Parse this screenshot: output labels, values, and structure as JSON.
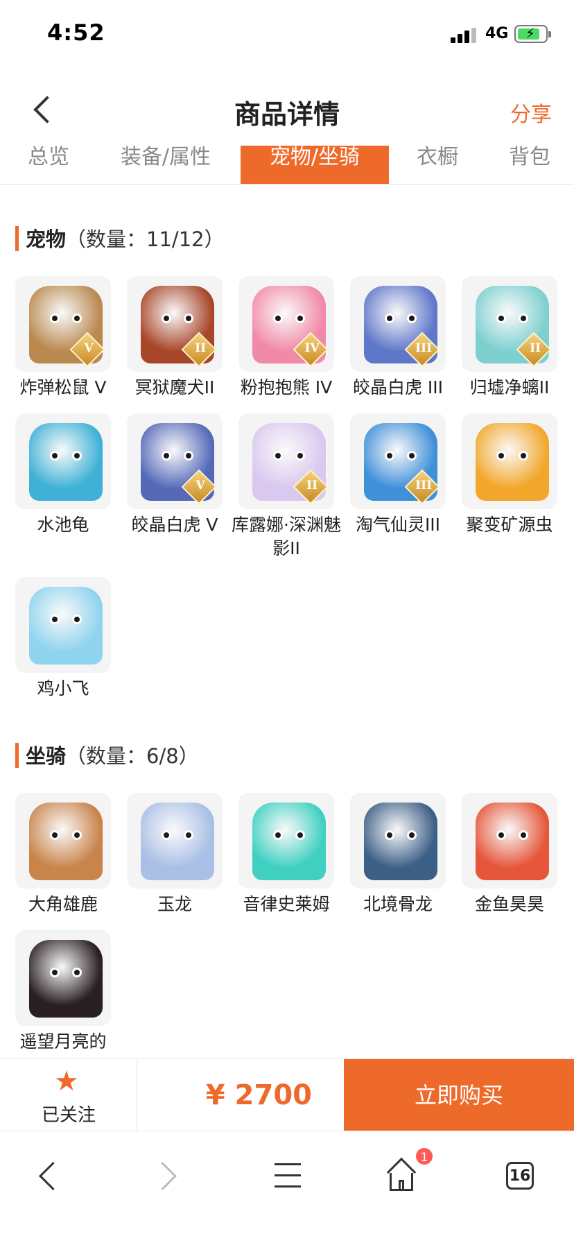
{
  "status": {
    "time": "4:52",
    "network": "4G"
  },
  "header": {
    "title": "商品详情",
    "share": "分享"
  },
  "tabs": [
    {
      "label": "总览",
      "active": false
    },
    {
      "label": "装备/属性",
      "active": false
    },
    {
      "label": "宠物/坐骑",
      "active": true
    },
    {
      "label": "衣橱",
      "active": false
    },
    {
      "label": "背包",
      "active": false
    }
  ],
  "pets": {
    "name": "宠物",
    "count": "（数量：11/12）",
    "items": [
      {
        "label": "炸弹松鼠 V",
        "icon": "squirrel-icon",
        "color": "#b9894f",
        "rank": "V"
      },
      {
        "label": "冥狱魔犬II",
        "icon": "hellhound-icon",
        "color": "#a8462a",
        "rank": "II"
      },
      {
        "label": "粉抱抱熊 IV",
        "icon": "pink-bear-icon",
        "color": "#f18aa8",
        "rank": "IV"
      },
      {
        "label": "皎晶白虎 III",
        "icon": "white-tiger-icon",
        "color": "#5f77c9",
        "rank": "III"
      },
      {
        "label": "归墟净螭II",
        "icon": "water-dragon-icon",
        "color": "#7ecfcf",
        "rank": "II"
      },
      {
        "label": "水池龟",
        "icon": "turtle-icon",
        "color": "#3fb1d6",
        "rank": ""
      },
      {
        "label": "皎晶白虎 V",
        "icon": "white-tiger-icon",
        "color": "#5569b8",
        "rank": "V"
      },
      {
        "label": "库露娜·深渊魅影II",
        "icon": "spirit-girl-icon",
        "color": "#d9c8ef",
        "rank": "II"
      },
      {
        "label": "淘气仙灵III",
        "icon": "blue-puppy-icon",
        "color": "#3f8fd9",
        "rank": "III"
      },
      {
        "label": "聚变矿源虫",
        "icon": "ore-bug-icon",
        "color": "#f2a72c",
        "rank": ""
      },
      {
        "label": "鸡小飞",
        "icon": "chick-icon",
        "color": "#8fd3ef",
        "rank": ""
      }
    ]
  },
  "mounts": {
    "name": "坐骑",
    "count": "（数量：6/8）",
    "items": [
      {
        "label": "大角雄鹿",
        "icon": "stag-icon",
        "color": "#c9844c"
      },
      {
        "label": "玉龙",
        "icon": "jade-dragon-icon",
        "color": "#a9bfe6"
      },
      {
        "label": "音律史莱姆",
        "icon": "slime-icon",
        "color": "#3fd0c2"
      },
      {
        "label": "北境骨龙",
        "icon": "bone-dragon-icon",
        "color": "#3c5f86"
      },
      {
        "label": "金鱼昊昊",
        "icon": "goldfish-icon",
        "color": "#e5563a"
      },
      {
        "label": "遥望月亮的",
        "icon": "pig-icon",
        "color": "#2a1f22"
      }
    ]
  },
  "actions": {
    "follow": "已关注",
    "price": "¥ 2700",
    "buy": "立即购买"
  },
  "browser": {
    "home_badge": "1",
    "tab_count": "16"
  },
  "colors": {
    "accent": "#ee6a2a"
  }
}
